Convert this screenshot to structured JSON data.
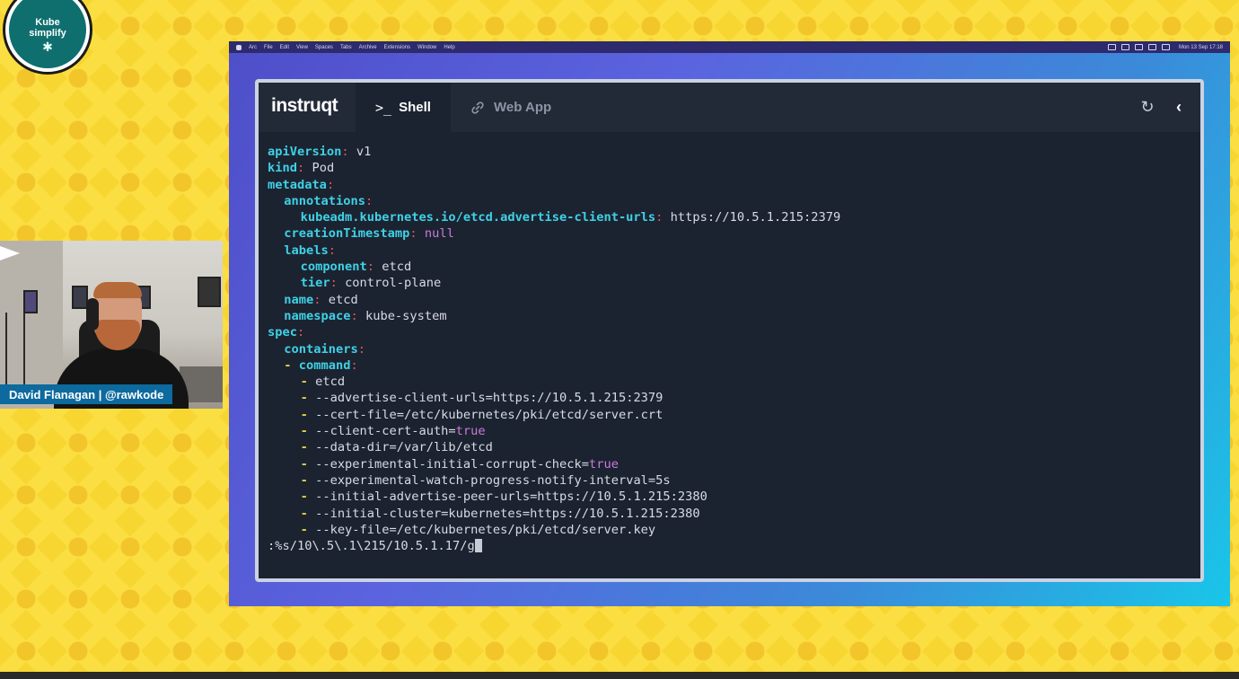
{
  "overlay": {
    "logo": {
      "line1": "Kube",
      "line2": "simplify"
    },
    "presenter_name": "David Flanagan | @rawkode"
  },
  "menubar": {
    "items": [
      "Arc",
      "File",
      "Edit",
      "View",
      "Spaces",
      "Tabs",
      "Archive",
      "Extensions",
      "Window",
      "Help"
    ],
    "clock": "Mon 13 Sep 17:18"
  },
  "app": {
    "brand": "instruqt",
    "tabs": [
      {
        "label": "Shell",
        "icon": "terminal-prompt-icon",
        "active": true
      },
      {
        "label": "Web App",
        "icon": "link-icon",
        "active": false
      }
    ],
    "actions": {
      "refresh_icon": "refresh-icon",
      "collapse_icon": "chevron-left-icon"
    }
  },
  "terminal": {
    "l1_key": "apiVersion",
    "l1_val": "v1",
    "l2_key": "kind",
    "l2_val": "Pod",
    "l3_key": "metadata",
    "l4_key": "annotations",
    "l5_key": "kubeadm.kubernetes.io/etcd.advertise-client-urls",
    "l5_val": "https://10.5.1.215:2379",
    "l6_key": "creationTimestamp",
    "l6_val": "null",
    "l7_key": "labels",
    "l8_key": "component",
    "l8_val": "etcd",
    "l9_key": "tier",
    "l9_val": "control-plane",
    "l10_key": "name",
    "l10_val": "etcd",
    "l11_key": "namespace",
    "l11_val": "kube-system",
    "l12_key": "spec",
    "l13_key": "containers",
    "l14_key": "command",
    "cmd1": "etcd",
    "cmd2": "--advertise-client-urls=https://10.5.1.215:2379",
    "cmd3": "--cert-file=/etc/kubernetes/pki/etcd/server.crt",
    "cmd4_a": "--client-cert-auth=",
    "cmd4_b": "true",
    "cmd5": "--data-dir=/var/lib/etcd",
    "cmd6_a": "--experimental-initial-corrupt-check=",
    "cmd6_b": "true",
    "cmd7": "--experimental-watch-progress-notify-interval=5s",
    "cmd8": "--initial-advertise-peer-urls=https://10.5.1.215:2380",
    "cmd9": "--initial-cluster=kubernetes=https://10.5.1.215:2380",
    "cmd10": "--key-file=/etc/kubernetes/pki/etcd/server.key",
    "command_line": ":%s/10\\.5\\.1\\215/10.5.1.17/g"
  },
  "colors": {
    "key": "#3fd1e6",
    "colon": "#e0555d",
    "null_bool": "#c77bdc",
    "dash": "#e4cf49",
    "badge": "#0d6a9e"
  }
}
